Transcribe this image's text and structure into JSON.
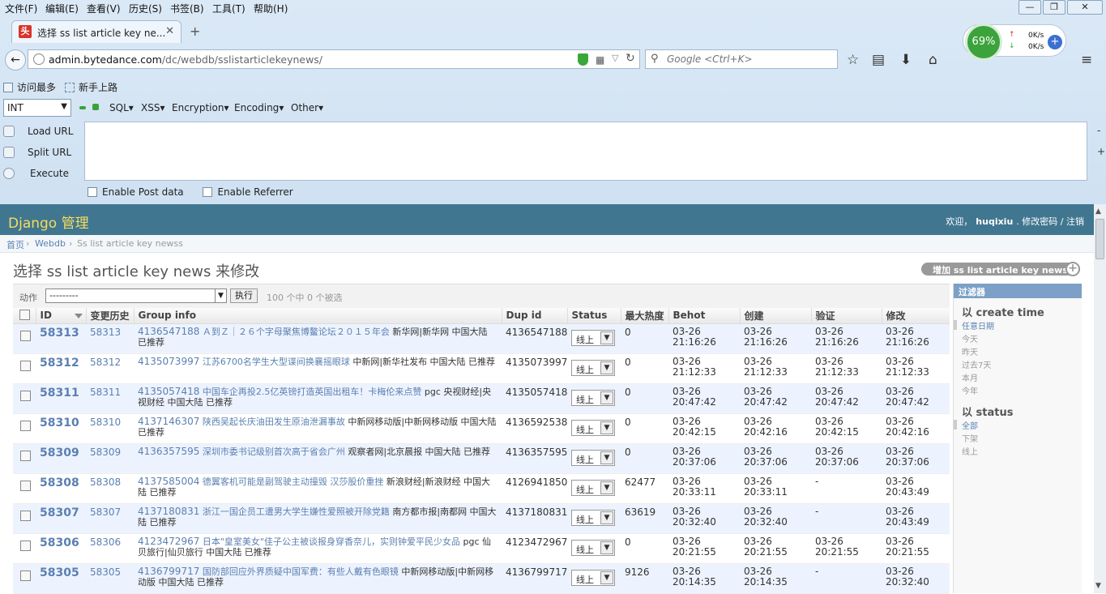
{
  "menu": [
    "文件(F)",
    "编辑(E)",
    "查看(V)",
    "历史(S)",
    "书签(B)",
    "工具(T)",
    "帮助(H)"
  ],
  "window_controls": {
    "minimize": "—",
    "restore": "❐",
    "close": "✕"
  },
  "tab": {
    "favicon": "头",
    "title": "选择 ss list article key ne...",
    "close": "✕",
    "new": "+"
  },
  "net": {
    "percent": "69%",
    "up": "0K/s",
    "down": "0K/s"
  },
  "url": {
    "domain": "admin.bytedance.com",
    "path": "/dc/webdb/sslistarticlekeynews/"
  },
  "search": {
    "placeholder": "Google <Ctrl+K>"
  },
  "bookmarks": [
    "访问最多",
    "新手上路"
  ],
  "hackbar": {
    "type_select": "INT",
    "menus": [
      "SQL",
      "XSS",
      "Encryption",
      "Encoding",
      "Other"
    ],
    "actions": [
      "Load URL",
      "Split URL",
      "Execute"
    ],
    "checks": [
      "Enable Post data",
      "Enable Referrer"
    ]
  },
  "django": {
    "brand": "Django 管理",
    "welcome": "欢迎，",
    "username": "huqixiu",
    "links": ". 修改密码 / 注销"
  },
  "breadcrumb": {
    "home": "首页",
    "app": "Webdb",
    "current": "Ss list article key newss"
  },
  "page_title": "选择 ss list article key news 来修改",
  "add_button": "增加 ss list article key news",
  "actions": {
    "label": "动作",
    "select": "---------",
    "go": "执行",
    "count": "100 个中 0 个被选"
  },
  "columns": [
    "ID",
    "变更历史",
    "Group info",
    "Dup id",
    "Status",
    "最大热度",
    "Behot",
    "创建",
    "验证",
    "修改"
  ],
  "rows": [
    {
      "id": "58313",
      "hist": "58313",
      "gid": "4136547188",
      "gtitle": "Ａ到Ｚ｜２６个字母聚焦博鳌论坛２０１５年会",
      "gsrc": "新华网|新华网 中国大陆 已推荐",
      "dup": "4136547188",
      "status": "线上",
      "hot": "0",
      "behot": [
        "03-26",
        "21:16:26"
      ],
      "created": [
        "03-26",
        "21:16:26"
      ],
      "verified": [
        "03-26",
        "21:16:26"
      ],
      "modified": [
        "03-26",
        "21:16:26"
      ]
    },
    {
      "id": "58312",
      "hist": "58312",
      "gid": "4135073997",
      "gtitle": "江苏6700名学生大型谍间换襄摇眼球",
      "gsrc": "中新网|新华社发布 中国大陆 已推荐",
      "dup": "4135073997",
      "status": "线上",
      "hot": "0",
      "behot": [
        "03-26",
        "21:12:33"
      ],
      "created": [
        "03-26",
        "21:12:33"
      ],
      "verified": [
        "03-26",
        "21:12:33"
      ],
      "modified": [
        "03-26",
        "21:12:33"
      ]
    },
    {
      "id": "58311",
      "hist": "58311",
      "gid": "4135057418",
      "gtitle": "中国车企再投2.5亿英镑打造英国出租车！卡梅伦来点赞",
      "gsrc": "pgc 央视财经|央视财经 中国大陆 已推荐",
      "dup": "4135057418",
      "status": "线上",
      "hot": "0",
      "behot": [
        "03-26",
        "20:47:42"
      ],
      "created": [
        "03-26",
        "20:47:42"
      ],
      "verified": [
        "03-26",
        "20:47:42"
      ],
      "modified": [
        "03-26",
        "20:47:42"
      ]
    },
    {
      "id": "58310",
      "hist": "58310",
      "gid": "4137146307",
      "gtitle": "陕西吴起长庆油田发生原油泄漏事故",
      "gsrc": "中新网移动版|中新网移动版 中国大陆 已推荐",
      "dup": "4136592538",
      "status": "线上",
      "hot": "0",
      "behot": [
        "03-26",
        "20:42:15"
      ],
      "created": [
        "03-26",
        "20:42:16"
      ],
      "verified": [
        "03-26",
        "20:42:15"
      ],
      "modified": [
        "03-26",
        "20:42:16"
      ]
    },
    {
      "id": "58309",
      "hist": "58309",
      "gid": "4136357595",
      "gtitle": "深圳市委书记级别首次高于省会广州",
      "gsrc": "观察者网|北京晨报 中国大陆 已推荐",
      "dup": "4136357595",
      "status": "线上",
      "hot": "0",
      "behot": [
        "03-26",
        "20:37:06"
      ],
      "created": [
        "03-26",
        "20:37:06"
      ],
      "verified": [
        "03-26",
        "20:37:06"
      ],
      "modified": [
        "03-26",
        "20:37:06"
      ]
    },
    {
      "id": "58308",
      "hist": "58308",
      "gid": "4137585004",
      "gtitle": "德翼客机可能是副驾驶主动撞毁 汉莎股价重挫",
      "gsrc": "新浪财经|新浪财经 中国大陆 已推荐",
      "dup": "4126941850",
      "status": "线上",
      "hot": "62477",
      "behot": [
        "03-26",
        "20:33:11"
      ],
      "created": [
        "03-26",
        "20:33:11"
      ],
      "verified": [
        "-"
      ],
      "modified": [
        "03-26",
        "20:43:49"
      ]
    },
    {
      "id": "58307",
      "hist": "58307",
      "gid": "4137180831",
      "gtitle": "浙江一国企员工遭男大学生嫌性爱照被开除党籍",
      "gsrc": "南方都市报|南都网 中国大陆 已推荐",
      "dup": "4137180831",
      "status": "线上",
      "hot": "63619",
      "behot": [
        "03-26",
        "20:32:40"
      ],
      "created": [
        "03-26",
        "20:32:40"
      ],
      "verified": [
        "-"
      ],
      "modified": [
        "03-26",
        "20:43:49"
      ]
    },
    {
      "id": "58306",
      "hist": "58306",
      "gid": "4123472967",
      "gtitle": "日本\"皇室美女\"佳子公主被谈报身穿香奈儿，实则钟爱平民少女品",
      "gsrc": "pgc 仙贝旅行|仙贝旅行 中国大陆 已推荐",
      "dup": "4123472967",
      "status": "线上",
      "hot": "0",
      "behot": [
        "03-26",
        "20:21:55"
      ],
      "created": [
        "03-26",
        "20:21:55"
      ],
      "verified": [
        "03-26",
        "20:21:55"
      ],
      "modified": [
        "03-26",
        "20:21:55"
      ]
    },
    {
      "id": "58305",
      "hist": "58305",
      "gid": "4136799717",
      "gtitle": "国防部回应外界质疑中国军费：有些人戴有色眼镜",
      "gsrc": "中新网移动版|中新网移动版 中国大陆 已推荐",
      "dup": "4136799717",
      "status": "线上",
      "hot": "9126",
      "behot": [
        "03-26",
        "20:14:35"
      ],
      "created": [
        "03-26",
        "20:14:35"
      ],
      "verified": [
        "-"
      ],
      "modified": [
        "03-26",
        "20:32:40"
      ]
    }
  ],
  "filter": {
    "title": "过滤器",
    "groups": [
      {
        "title": "以 create time",
        "options": [
          "任意日期",
          "今天",
          "昨天",
          "过去7天",
          "本月",
          "今年"
        ]
      },
      {
        "title": "以 status",
        "options": [
          "全部",
          "下架",
          "线上"
        ]
      }
    ]
  }
}
